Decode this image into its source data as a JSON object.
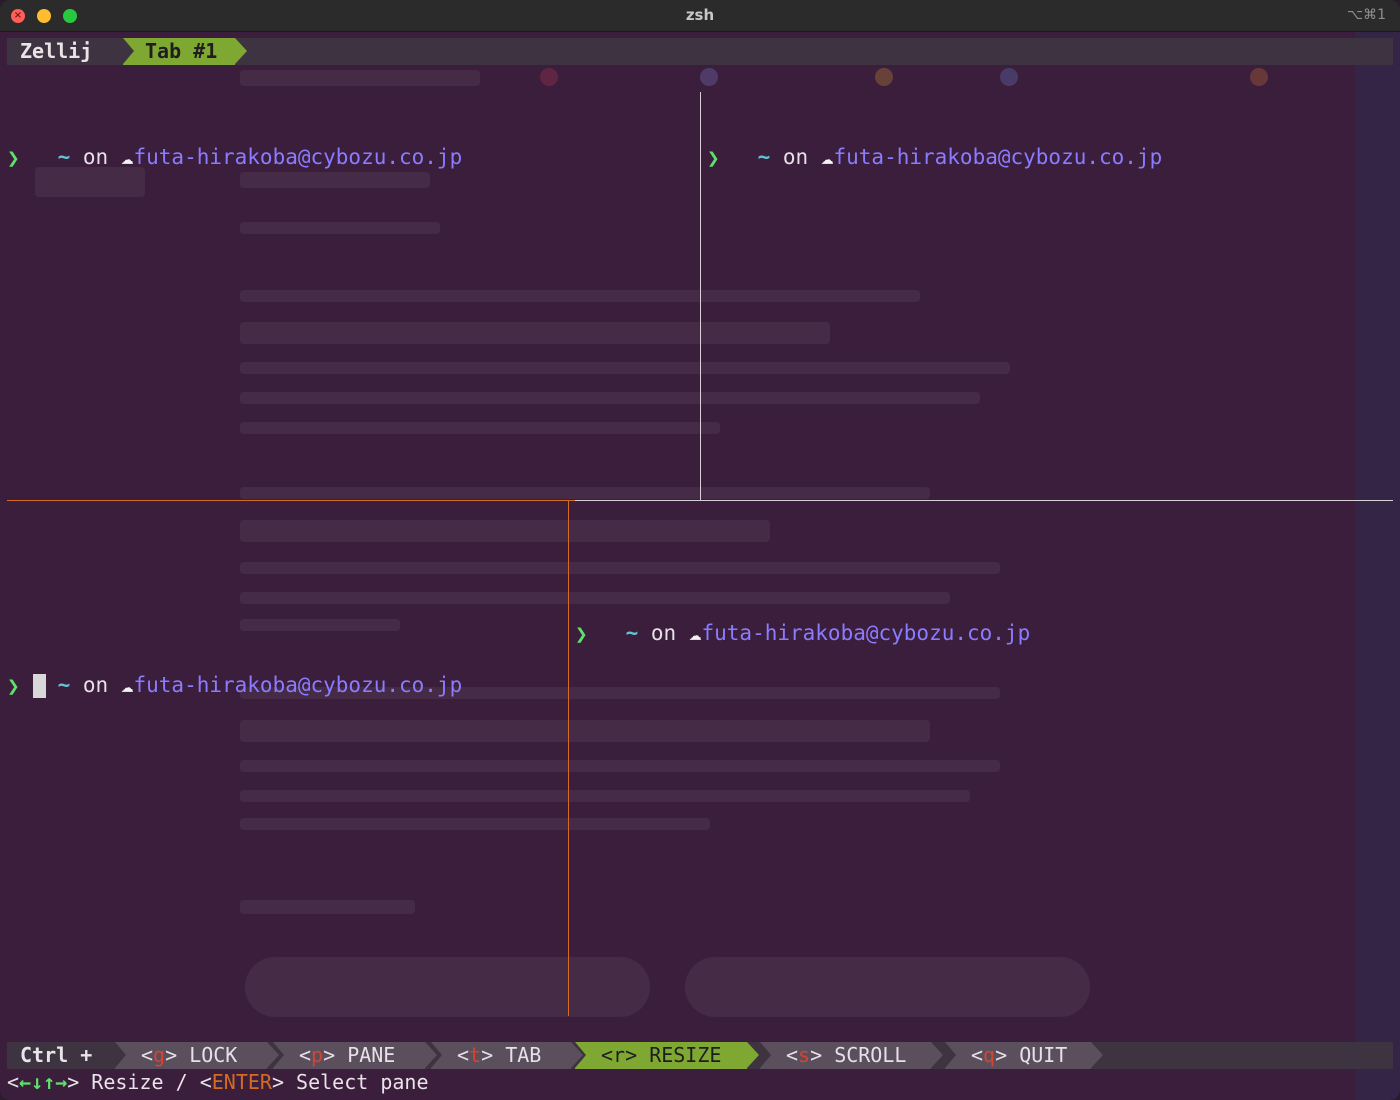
{
  "window": {
    "title": "zsh",
    "shortcut": "⌥⌘1"
  },
  "tabbar": {
    "app_name": "Zellij",
    "active_tab": "Tab #1"
  },
  "panes": [
    {
      "dir": "~",
      "on": "on",
      "cloud_icon": "☁",
      "account": "futa-hirakoba@cybozu.co.jp",
      "caret": "❯"
    },
    {
      "dir": "~",
      "on": "on",
      "cloud_icon": "☁",
      "account": "futa-hirakoba@cybozu.co.jp",
      "caret": "❯"
    },
    {
      "dir": "~",
      "on": "on",
      "cloud_icon": "☁",
      "account": "futa-hirakoba@cybozu.co.jp",
      "caret": "❯",
      "focused": true
    },
    {
      "dir": "~",
      "on": "on",
      "cloud_icon": "☁",
      "account": "futa-hirakoba@cybozu.co.jp",
      "caret": "❯"
    }
  ],
  "statusbar": {
    "modifier": "Ctrl +",
    "modes": [
      {
        "open": "<",
        "key": "g",
        "close": ">",
        "label": "LOCK"
      },
      {
        "open": "<",
        "key": "p",
        "close": ">",
        "label": "PANE"
      },
      {
        "open": "<",
        "key": "t",
        "close": ">",
        "label": "TAB"
      },
      {
        "open": "<",
        "key": "r",
        "close": ">",
        "label": "RESIZE",
        "active": true
      },
      {
        "open": "<",
        "key": "s",
        "close": ">",
        "label": "SCROLL"
      },
      {
        "open": "<",
        "key": "q",
        "close": ">",
        "label": "QUIT"
      }
    ]
  },
  "hint": {
    "lt1": "<",
    "arrows": "←↓↑→",
    "gt1": ">",
    "resize": " Resize / ",
    "lt2": "<",
    "enter_key": "ENTER",
    "gt2": ">",
    "select": " Select pane"
  },
  "colors": {
    "background": "#3b1e3c",
    "active_mode": "#7fa832",
    "focus_border": "#d46b22",
    "account": "#8a7cff",
    "caret": "#5fe06a"
  }
}
